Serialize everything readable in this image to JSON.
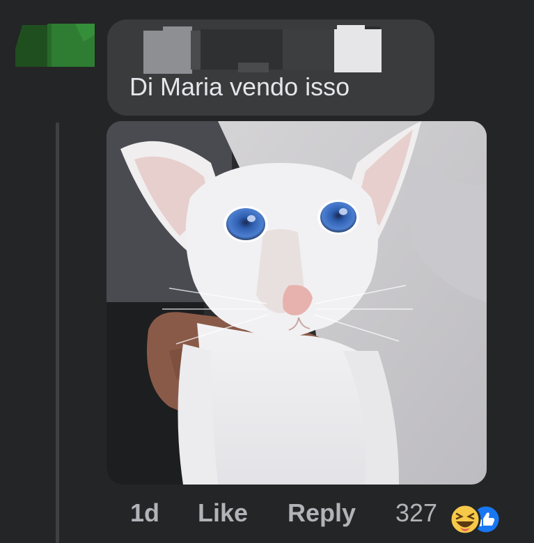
{
  "comment": {
    "text": "Di Maria vendo isso"
  },
  "attachment": {
    "icon": "cat-photo",
    "subject": "white oriental shorthair cat with blue eyes held in a hand"
  },
  "actions": {
    "time": "1d",
    "like_label": "Like",
    "reply_label": "Reply"
  },
  "reactions": {
    "count": "327",
    "icons": [
      "haha-icon",
      "like-icon"
    ]
  },
  "colors": {
    "background": "#242526",
    "bubble": "#3a3b3c",
    "text": "#e4e6eb",
    "secondary_text": "#b0b3b8",
    "like_blue": "#1877f2",
    "haha_yellow": "#f7c948"
  }
}
